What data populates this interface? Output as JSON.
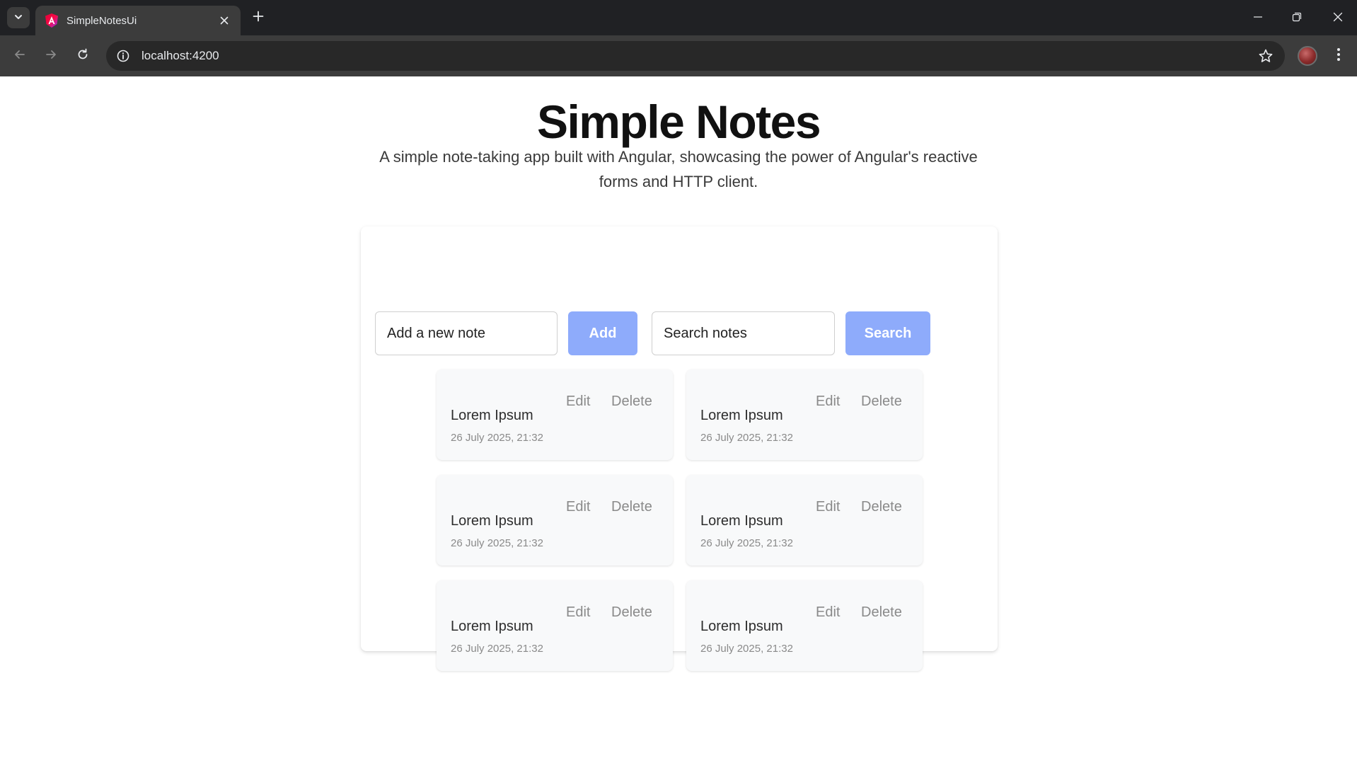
{
  "browser": {
    "tab_title": "SimpleNotesUi",
    "url": "localhost:4200",
    "icons": {
      "tab_search": "chevron-down-icon",
      "favicon": "angular-icon",
      "tab_close": "close-icon",
      "new_tab": "plus-icon",
      "minimize": "minimize-icon",
      "restore": "restore-icon",
      "close_window": "close-icon",
      "back": "arrow-left-icon",
      "forward": "arrow-right-icon",
      "reload": "reload-icon",
      "site_info": "info-icon",
      "bookmark": "star-icon",
      "profile": "avatar",
      "menu": "more-vertical-icon"
    }
  },
  "app": {
    "title": "Simple Notes",
    "subtitle": "A simple note-taking app built with Angular, showcasing the power of Angular's reactive forms and HTTP client.",
    "new_note_placeholder": "Add a new note",
    "add_label": "Add",
    "search_placeholder": "Search notes",
    "search_label": "Search",
    "accent_color": "#8eabfb"
  },
  "notes": [
    {
      "title": "Lorem Ipsum",
      "date": "26 July 2025, 21:32",
      "edit_label": "Edit",
      "delete_label": "Delete"
    },
    {
      "title": "Lorem Ipsum",
      "date": "26 July 2025, 21:32",
      "edit_label": "Edit",
      "delete_label": "Delete"
    },
    {
      "title": "Lorem Ipsum",
      "date": "26 July 2025, 21:32",
      "edit_label": "Edit",
      "delete_label": "Delete"
    },
    {
      "title": "Lorem Ipsum",
      "date": "26 July 2025, 21:32",
      "edit_label": "Edit",
      "delete_label": "Delete"
    },
    {
      "title": "Lorem Ipsum",
      "date": "26 July 2025, 21:32",
      "edit_label": "Edit",
      "delete_label": "Delete"
    },
    {
      "title": "Lorem Ipsum",
      "date": "26 July 2025, 21:32",
      "edit_label": "Edit",
      "delete_label": "Delete"
    }
  ]
}
